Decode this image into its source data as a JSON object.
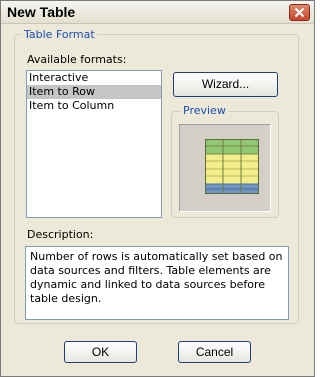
{
  "window": {
    "title": "New Table"
  },
  "group": {
    "legend": "Table Format"
  },
  "formats": {
    "label": "Available formats:",
    "items": [
      "Interactive",
      "Item to Row",
      "Item to Column"
    ],
    "selected": "Item to Row"
  },
  "buttons": {
    "wizard": "Wizard...",
    "ok": "OK",
    "cancel": "Cancel"
  },
  "preview": {
    "label": "Preview"
  },
  "description": {
    "label": "Description:",
    "text": "Number of rows is automatically set based on data sources and filters. Table elements are dynamic and linked to data sources before table design."
  },
  "colors": {
    "accent": "#1c4fb5",
    "preview_green": "#8fc870",
    "preview_yellow": "#f2ef8a",
    "preview_blue": "#6f96c4"
  }
}
